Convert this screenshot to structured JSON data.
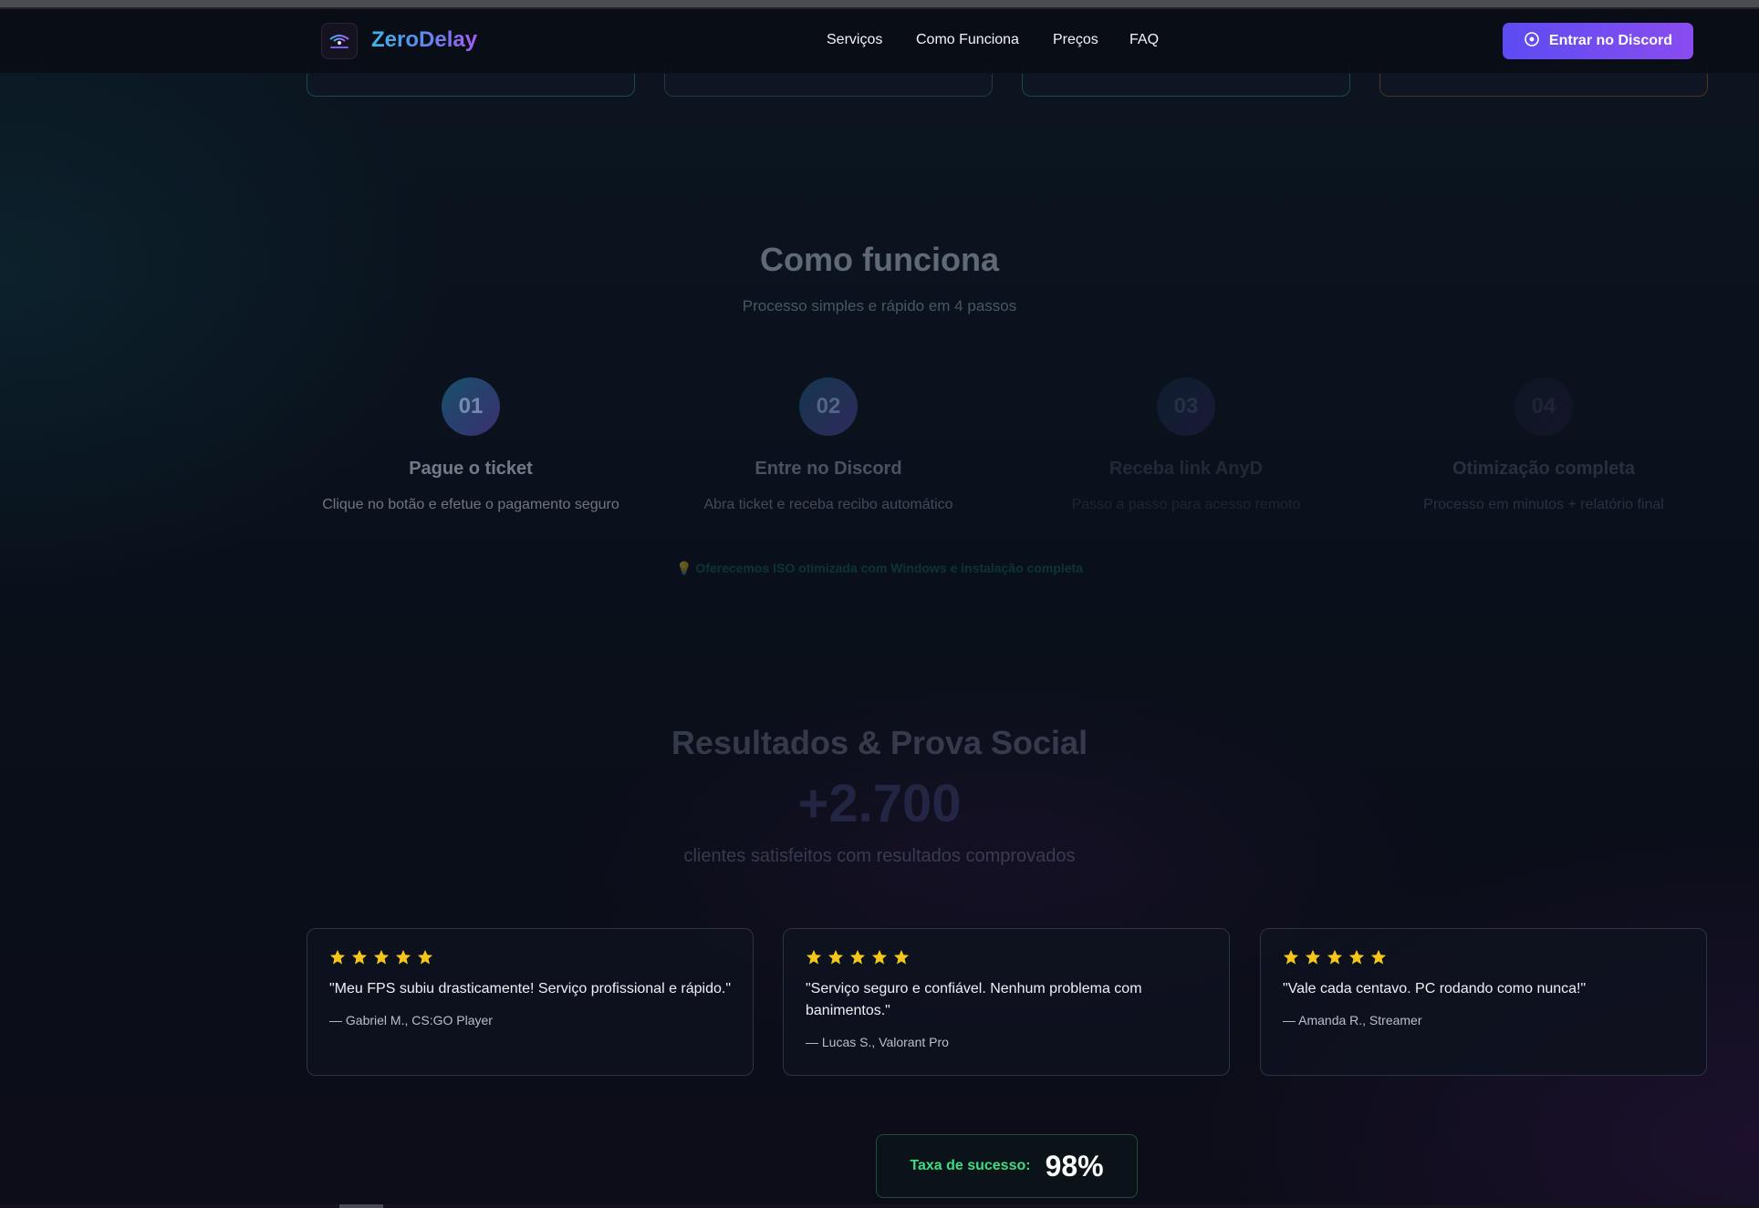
{
  "brand": {
    "name": "ZeroDelay",
    "logo_icon": "zerodelay-logo-icon"
  },
  "nav": {
    "items": [
      {
        "label": "Serviços"
      },
      {
        "label": "Como Funciona"
      },
      {
        "label": "Preços"
      },
      {
        "label": "FAQ"
      }
    ],
    "cta": {
      "label": "Entrar no Discord",
      "icon": "discord-icon"
    }
  },
  "how": {
    "title": "Como funciona",
    "subtitle": "Processo simples e rápido em 4 passos",
    "steps": [
      {
        "number": "01",
        "title": "Pague o ticket",
        "desc": "Clique no botão e efetue o pagamento seguro"
      },
      {
        "number": "02",
        "title": "Entre no Discord",
        "desc": "Abra ticket e receba recibo automático"
      },
      {
        "number": "03",
        "title": "Receba link AnyD",
        "desc": "Passo a passo para acesso remoto"
      },
      {
        "number": "04",
        "title": "Otimização completa",
        "desc": "Processo em minutos + relatório final"
      }
    ],
    "tip": "Oferecemos ISO otimizada com Windows e instalação completa",
    "tip_icon": "lightbulb-icon"
  },
  "results": {
    "title": "Resultados & Prova Social",
    "count": "+2.700",
    "count_label": "clientes satisfeitos com resultados comprovados"
  },
  "testimonials": [
    {
      "rating": 5,
      "quote": "\"Meu FPS subiu drasticamente! Serviço profissional e rápido.\"",
      "author": "— Gabriel M., CS:GO Player"
    },
    {
      "rating": 5,
      "quote": "\"Serviço seguro e confiável. Nenhum problema com banimentos.\"",
      "author": "— Lucas S., Valorant Pro"
    },
    {
      "rating": 5,
      "quote": "\"Vale cada centavo. PC rodando como nunca!\"",
      "author": "— Amanda R., Streamer"
    }
  ],
  "success": {
    "label": "Taxa de sucesso:",
    "value": "98%"
  },
  "colors": {
    "accent_purple": "#7c4cf1",
    "accent_cyan": "#3fb5e8",
    "star": "#f5c518",
    "success_green": "#3ddc84"
  }
}
